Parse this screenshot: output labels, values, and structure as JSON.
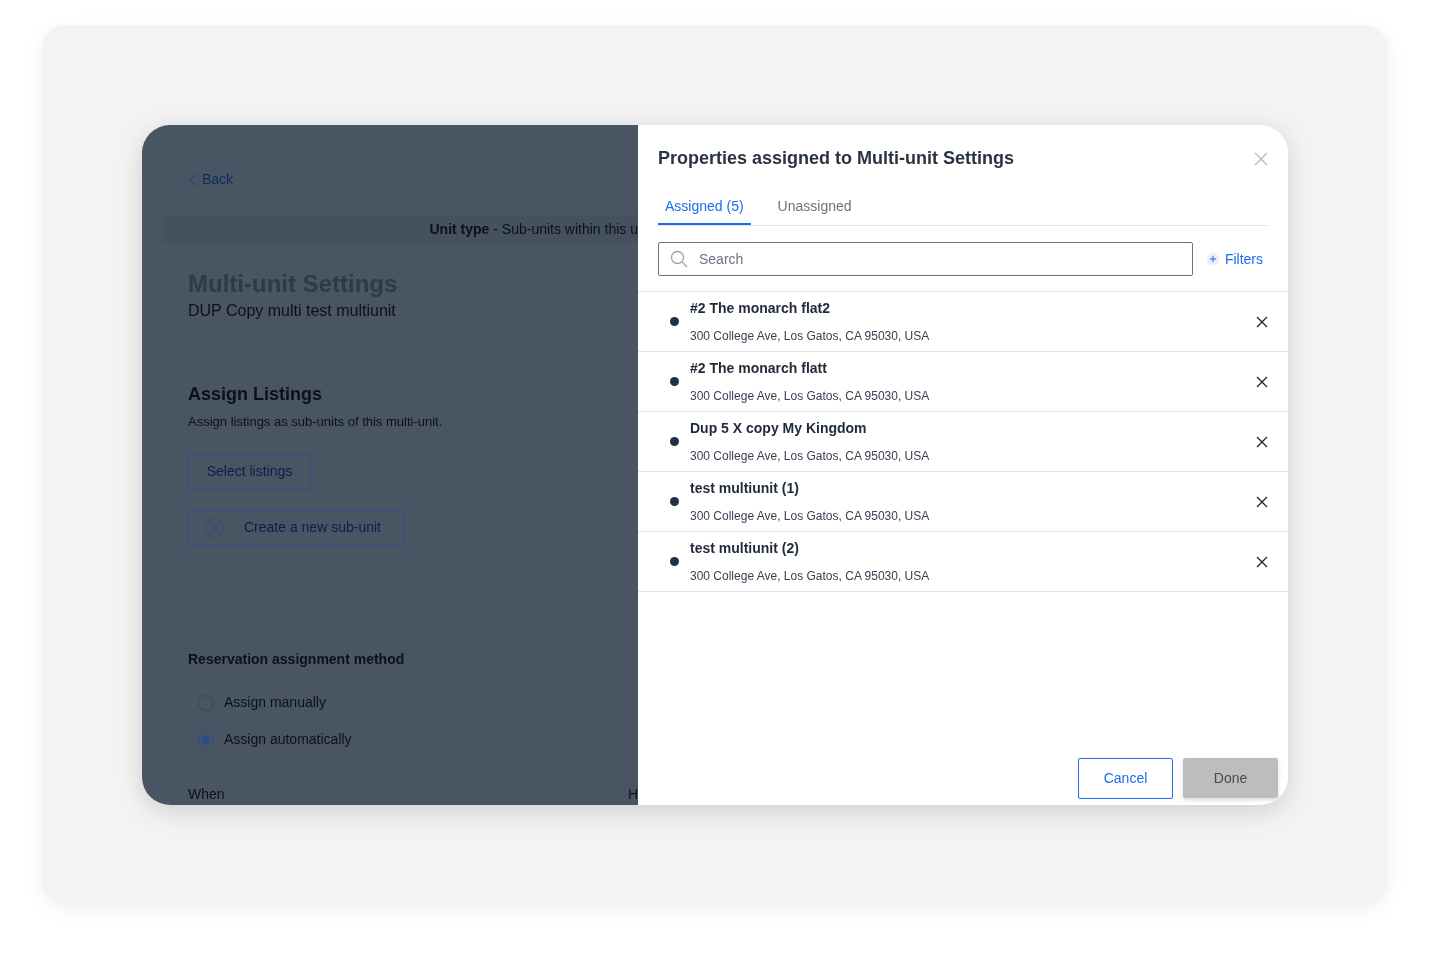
{
  "background_page": {
    "back_link": "Back",
    "banner": {
      "label": "Unit type",
      "text": " - Sub-units within this u"
    },
    "title": "Multi-unit Settings",
    "subtitle": "DUP Copy multi test multiunit",
    "assign": {
      "title": "Assign Listings",
      "description": "Assign listings as sub-units of this multi-unit.",
      "select_button": "Select listings",
      "create_button": "Create a new sub-unit"
    },
    "reservation": {
      "title": "Reservation assignment method",
      "options": [
        {
          "label": "Assign manually",
          "selected": false
        },
        {
          "label": "Assign automatically",
          "selected": true
        }
      ]
    },
    "bottom_labels": [
      "When",
      "H"
    ]
  },
  "drawer": {
    "title": "Properties assigned to Multi-unit Settings",
    "tabs": [
      {
        "label": "Assigned (5)",
        "selected": true
      },
      {
        "label": "Unassigned",
        "selected": false
      }
    ],
    "search": {
      "placeholder": "Search"
    },
    "filters": "Filters",
    "items": [
      {
        "name": "#2 The monarch flat2",
        "address": "300 College Ave, Los Gatos, CA 95030, USA"
      },
      {
        "name": "#2 The monarch flatt",
        "address": "300 College Ave, Los Gatos, CA 95030, USA"
      },
      {
        "name": "Dup 5 X copy My Kingdom",
        "address": "300 College Ave, Los Gatos, CA 95030, USA"
      },
      {
        "name": "test multiunit (1)",
        "address": "300 College Ave, Los Gatos, CA 95030, USA"
      },
      {
        "name": "test multiunit (2)",
        "address": "300 College Ave, Los Gatos, CA 95030, USA"
      }
    ],
    "cancel": "Cancel",
    "done": {
      "label": "Done",
      "disabled": true
    }
  }
}
